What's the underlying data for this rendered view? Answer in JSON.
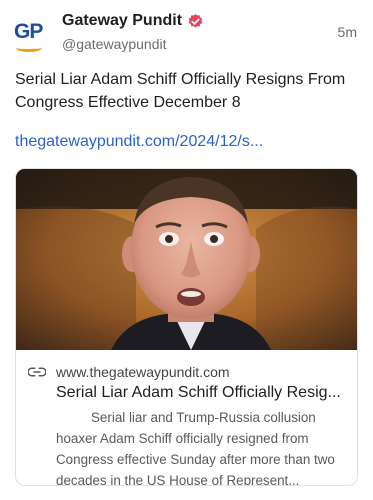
{
  "post": {
    "author": {
      "display_name": "Gateway Pundit",
      "handle": "@gatewaypundit",
      "avatar_text": "GP",
      "verified_icon": "verified-badge-icon"
    },
    "timestamp": "5m",
    "text": "Serial Liar Adam Schiff Officially Resigns From Congress Effective December 8",
    "link_text": "thegatewaypundit.com/2024/12/s..."
  },
  "card": {
    "domain": "www.thegatewaypundit.com",
    "domain_icon": "link-icon",
    "title": "Serial Liar Adam Schiff Officially Resig...",
    "description": "Serial liar and Trump-Russia collusion hoaxer Adam Schiff officially resigned from Congress effective Sunday after more than two decades in the US House of Represent..."
  },
  "colors": {
    "brand_blue": "#1d4ea3",
    "brand_orange": "#e8a21b",
    "verified_pink": "#e8455b",
    "link_blue": "#2a62c9"
  }
}
